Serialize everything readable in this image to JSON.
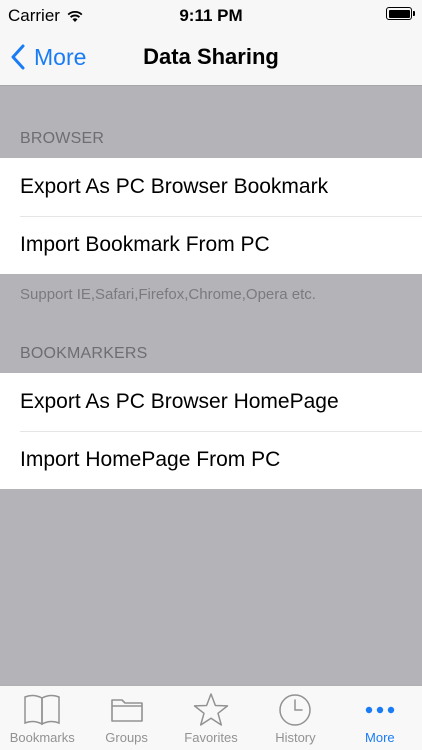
{
  "status_bar": {
    "carrier": "Carrier",
    "time": "9:11 PM"
  },
  "nav": {
    "back_label": "More",
    "title": "Data Sharing"
  },
  "sections": [
    {
      "header": "BROWSER",
      "rows": [
        "Export As PC Browser Bookmark",
        "Import Bookmark From PC"
      ],
      "footer": "Support IE,Safari,Firefox,Chrome,Opera etc."
    },
    {
      "header": "BOOKMARKERS",
      "rows": [
        "Export As PC Browser HomePage",
        "Import HomePage From PC"
      ]
    }
  ],
  "tab_bar": {
    "items": [
      {
        "label": "Bookmarks",
        "icon": "book-icon"
      },
      {
        "label": "Groups",
        "icon": "folder-icon"
      },
      {
        "label": "Favorites",
        "icon": "star-icon"
      },
      {
        "label": "History",
        "icon": "clock-icon"
      },
      {
        "label": "More",
        "icon": "more-dots-icon",
        "active": true
      }
    ]
  },
  "colors": {
    "accent": "#1a7cf5",
    "background": "#b3b3b8",
    "inactive_tab": "#929292"
  }
}
